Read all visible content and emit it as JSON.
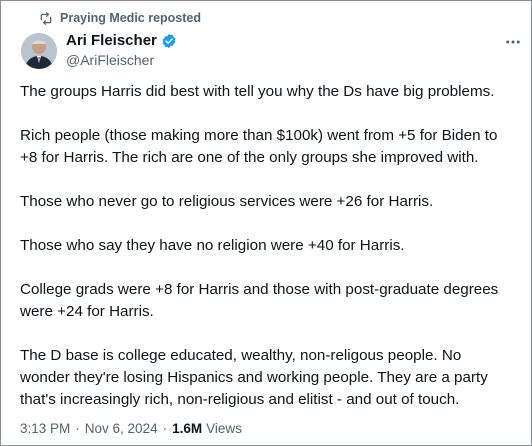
{
  "repost": {
    "icon": "repost-icon",
    "text": "Praying Medic reposted"
  },
  "author": {
    "name": "Ari Fleischer",
    "handle": "@AriFleischer",
    "verified_icon": "verified-badge-icon",
    "verified_color": "#1d9bf0"
  },
  "menu": {
    "icon": "more-options-icon"
  },
  "tweet": {
    "paragraphs": [
      "The groups Harris did best with tell you why the Ds have big problems.",
      "Rich people (those making more than $100k) went from +5 for Biden to\n+8 for Harris.  The rich are one of the only groups she improved with.",
      "Those who never go to religious services were +26 for Harris.",
      "Those who say they have no religion were +40 for Harris.",
      "College grads were +8 for Harris and those with post-graduate degrees\nwere +24 for Harris.",
      "The D base is college educated, wealthy, non-religous people.  No\nwonder they're losing Hispanics and working people.  They are a party\nthat's increasingly rich, non-religious and elitist - and out of touch."
    ]
  },
  "meta": {
    "time": "3:13 PM",
    "separator1": "·",
    "date": "Nov 6, 2024",
    "separator2": "·",
    "views_count": "1.6M",
    "views_label": "Views"
  }
}
